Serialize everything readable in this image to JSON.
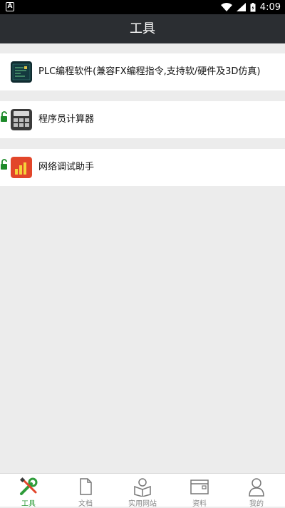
{
  "status_bar": {
    "time": "4:09",
    "left_glyph": "A"
  },
  "header": {
    "title": "工具"
  },
  "tools": [
    {
      "label": "PLC编程软件(兼容FX编程指令,支持软/硬件及3D仿真)",
      "icon": "plc-software-icon",
      "locked": false
    },
    {
      "label": "程序员计算器",
      "icon": "calculator-icon",
      "locked": true
    },
    {
      "label": "网络调试助手",
      "icon": "network-debug-icon",
      "locked": true
    }
  ],
  "bottom_nav": [
    {
      "label": "工具",
      "icon": "tools-icon",
      "active": true
    },
    {
      "label": "文档",
      "icon": "document-icon",
      "active": false
    },
    {
      "label": "实用网站",
      "icon": "website-icon",
      "active": false
    },
    {
      "label": "资料",
      "icon": "folder-icon",
      "active": false
    },
    {
      "label": "我的",
      "icon": "user-icon",
      "active": false
    }
  ],
  "colors": {
    "header_bg": "#2b2e32",
    "active_nav": "#2e9c3a",
    "lock_green": "#1e8a2a",
    "page_bg": "#ececec"
  }
}
